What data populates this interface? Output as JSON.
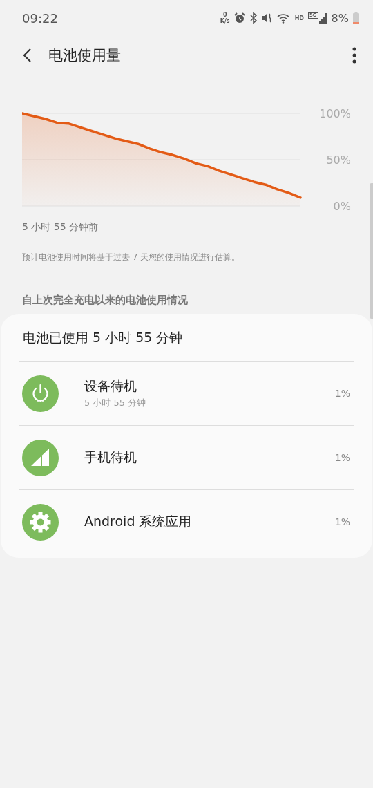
{
  "status_bar": {
    "time": "09:22",
    "speed_value": "0",
    "speed_unit": "K/s",
    "hd": "HD",
    "network": "5G",
    "battery": "8%"
  },
  "app_bar": {
    "title": "电池使用量"
  },
  "usage_chart": {
    "chart_data": {
      "type": "area",
      "ylim": [
        0,
        100
      ],
      "yticks": [
        {
          "value": 0,
          "label": "0%"
        },
        {
          "value": 50,
          "label": "50%"
        },
        {
          "value": 100,
          "label": "100%"
        }
      ],
      "series": [
        {
          "color": "#e35b16",
          "values": [
            100,
            97,
            94,
            90,
            89,
            85,
            81,
            77,
            73,
            70,
            67,
            62,
            58,
            55,
            51,
            46,
            43,
            38,
            34,
            30,
            26,
            23,
            18,
            14,
            9
          ]
        }
      ]
    },
    "start_label": "5 小时 55 分钟前"
  },
  "estimate_note": "预计电池使用时间将基于过去 7 天您的使用情况进行估算。",
  "section_header": "自上次完全充电以来的电池使用情况",
  "usage_card": {
    "title": "电池已使用 5 小时 55 分钟",
    "items": [
      {
        "kind": "power",
        "name": "设备待机",
        "detail": "5 小时 55 分钟",
        "percent": "1%"
      },
      {
        "kind": "signal",
        "name": "手机待机",
        "percent": "1%"
      },
      {
        "kind": "gear",
        "name": "Android 系统应用",
        "percent": "1%"
      }
    ]
  }
}
